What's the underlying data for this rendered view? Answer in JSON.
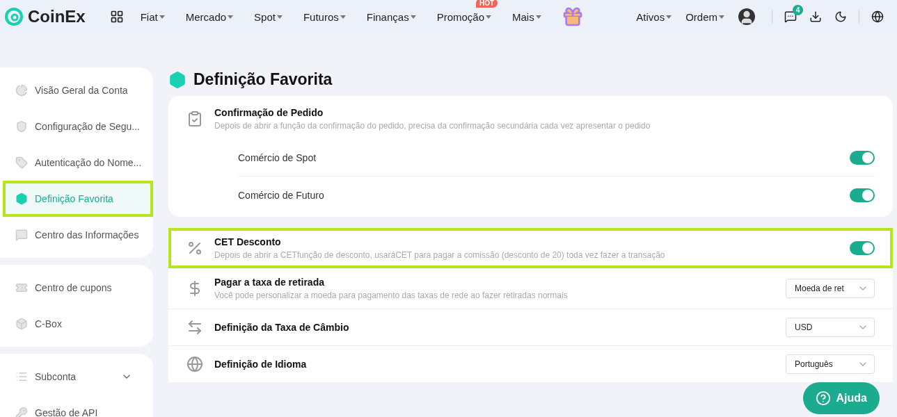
{
  "header": {
    "logo": "CoinEx",
    "menu": [
      {
        "label": "Fiat"
      },
      {
        "label": "Mercado"
      },
      {
        "label": "Spot"
      },
      {
        "label": "Futuros"
      },
      {
        "label": "Finanças"
      },
      {
        "label": "Promoção",
        "badge": "HOT"
      },
      {
        "label": "Mais"
      }
    ],
    "right_menu": [
      {
        "label": "Ativos"
      },
      {
        "label": "Ordem"
      }
    ],
    "messages_badge": "4"
  },
  "sidebar": {
    "groups": [
      {
        "items": [
          {
            "label": "Visão Geral da Conta",
            "selected": false
          },
          {
            "label": "Configuração de Segu...",
            "selected": false
          },
          {
            "label": "Autenticação do Nome...",
            "selected": false
          },
          {
            "label": "Definição Favorita",
            "selected": true
          },
          {
            "label": "Centro das Informações",
            "selected": false
          }
        ]
      },
      {
        "items": [
          {
            "label": "Centro de cupons",
            "selected": false
          },
          {
            "label": "C-Box",
            "selected": false
          }
        ]
      },
      {
        "items": [
          {
            "label": "Subconta",
            "selected": false,
            "expanded": false
          },
          {
            "label": "Gestão de API",
            "selected": false
          }
        ]
      }
    ]
  },
  "page_title": "Definição Favorita",
  "sections": [
    {
      "kind": "group",
      "title": "Confirmação de Pedido",
      "description": "Depois de abrir a função da confirmação do pedido, precisa da confirmação secundária cada vez apresentar o pedido",
      "highlighted": false,
      "items": [
        {
          "label": "Comércio de Spot",
          "on": true
        },
        {
          "label": "Comércio de Futuro",
          "on": true
        }
      ]
    },
    {
      "kind": "toggle",
      "title": "CET Desconto",
      "description": "Depois de abrir a CETfunção de desconto, usaráCET para pagar a comissão (desconto de 20) toda vez fazer a transação",
      "on": true,
      "highlighted": true
    },
    {
      "kind": "select",
      "title": "Pagar a taxa de retirada",
      "description": "Você pode personalizar a moeda para pagamento das taxas de rede ao fazer retiradas normais",
      "value": "Moeda de ret",
      "highlighted": false
    },
    {
      "kind": "select",
      "title": "Definição da Taxa de Câmbio",
      "value": "USD",
      "highlighted": false
    },
    {
      "kind": "select",
      "title": "Definição de Idioma",
      "value": "Português",
      "highlighted": false
    }
  ],
  "help_button": "Ajuda"
}
